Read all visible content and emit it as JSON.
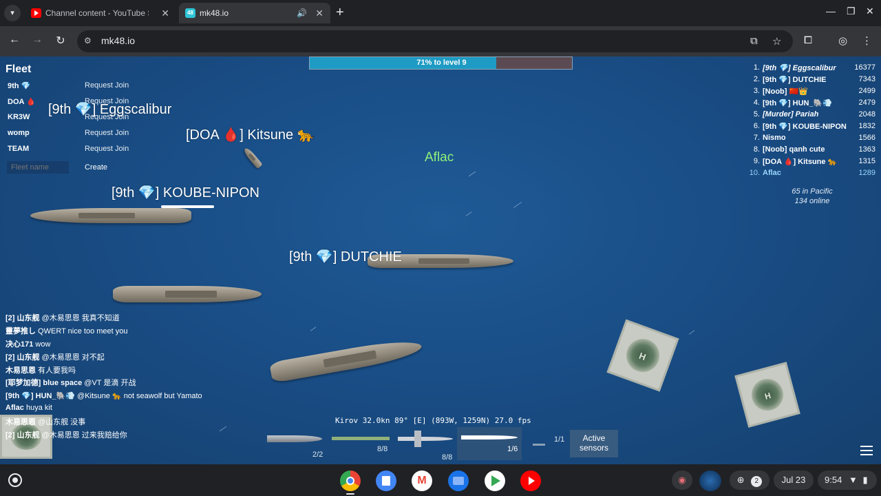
{
  "browser": {
    "tabs": [
      {
        "title": "Channel content - YouTube Studio",
        "icon": "youtube-icon"
      },
      {
        "title": "mk48.io",
        "icon": "mk48-icon"
      }
    ],
    "new_tab": "+",
    "url": "mk48.io"
  },
  "game": {
    "progress": {
      "label": "71% to level 9",
      "fraction": 0.71
    },
    "fleet": {
      "title": "Fleet",
      "rows": [
        {
          "name": "9th 💎",
          "action": "Request Join"
        },
        {
          "name": "DOA 🩸",
          "action": "Request Join"
        },
        {
          "name": "KR3W",
          "action": "Request Join"
        },
        {
          "name": "womp",
          "action": "Request Join"
        },
        {
          "name": "TEAM",
          "action": "Request Join"
        }
      ],
      "name_placeholder": "Fleet name",
      "create_label": "Create"
    },
    "players": [
      {
        "label": "[9th 💎] Eggscalibur"
      },
      {
        "label": "[DOA 🩸] Kitsune 🐆"
      },
      {
        "label": "[9th 💎] KOUBE-NIPON"
      },
      {
        "label": "[9th 💎] DUTCHIE"
      }
    ],
    "self_label": "Aflac",
    "leaderboard": [
      {
        "rank": "1.",
        "name": "[9th 💎] Eggscalibur",
        "score": "16377"
      },
      {
        "rank": "2.",
        "name": "[9th 💎] DUTCHIE",
        "score": "7343"
      },
      {
        "rank": "3.",
        "name": "[Noob] 🇨🇳👑",
        "score": "2499"
      },
      {
        "rank": "4.",
        "name": "[9th 💎] HUN_🐘💨",
        "score": "2479"
      },
      {
        "rank": "5.",
        "name": "[Murder] Pariah",
        "score": "2048"
      },
      {
        "rank": "6.",
        "name": "[9th 💎] KOUBE-NIPON",
        "score": "1832"
      },
      {
        "rank": "7.",
        "name": "Nismo",
        "score": "1566"
      },
      {
        "rank": "8.",
        "name": "[Noob] qanh cute",
        "score": "1363"
      },
      {
        "rank": "9.",
        "name": "[DOA 🩸] Kitsune 🐆",
        "score": "1315"
      },
      {
        "rank": "10.",
        "name": "Aflac",
        "score": "1289"
      }
    ],
    "online": {
      "region": "65 in Pacific",
      "total": "134 online"
    },
    "chat": [
      {
        "user": "[2] 山东舰",
        "msg": " @木易思恩 我真不知道"
      },
      {
        "user": "靈夢推し",
        "msg": " QWERT nice too meet you"
      },
      {
        "user": "决心171",
        "msg": " wow"
      },
      {
        "user": "[2] 山东舰",
        "msg": " @木易思恩 对不起"
      },
      {
        "user": "木易思恩",
        "msg": " 有人要我吗"
      },
      {
        "user": "[耶梦加德] blue space",
        "msg": " @VT 是滴 开战"
      },
      {
        "user": "[9th 💎] HUN_🐘💨",
        "msg": " @Kitsune 🐆 not seawolf but Yamato"
      },
      {
        "user": "Aflac",
        "msg": " huya kit"
      },
      {
        "user": "木易思恩",
        "msg": " @山东舰 没事"
      },
      {
        "user": "[2] 山东舰",
        "msg": " @木易思恩 过来我赔给你"
      }
    ],
    "status": "Kirov 32.0kn  89° [E]  (893W, 1259N)  27.0 fps",
    "weapons": [
      {
        "count": "2/2",
        "icon": "torpedo-icon"
      },
      {
        "count": "8/8",
        "icon": "missile-icon"
      },
      {
        "count": "8/8",
        "icon": "cruise-missile-icon"
      },
      {
        "count": "1/6",
        "icon": "sam-icon"
      },
      {
        "count": "1/1",
        "icon": "decoy-icon"
      }
    ],
    "sensors_label": "Active sensors"
  },
  "shelf": {
    "apps": [
      "chrome-icon",
      "docs-icon",
      "gmail-icon",
      "files-icon",
      "play-store-icon",
      "youtube-icon"
    ],
    "notifications": "2",
    "date": "Jul 23",
    "time": "9:54"
  }
}
